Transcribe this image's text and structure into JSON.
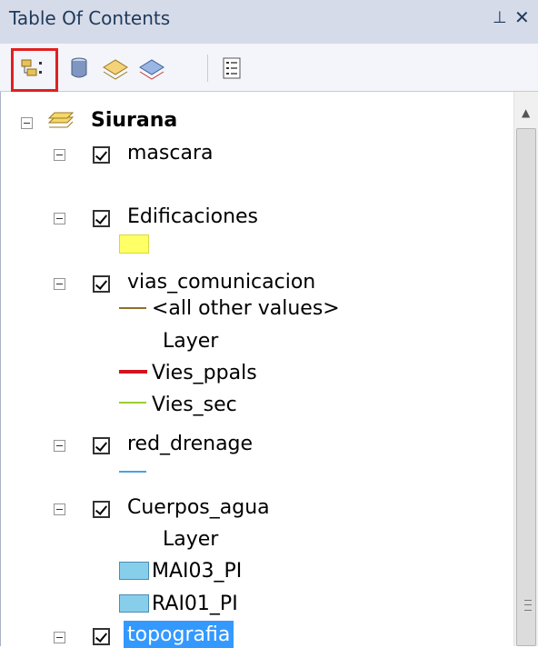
{
  "window": {
    "title": "Table Of Contents",
    "pin_glyph": "⊥",
    "close_glyph": "✕"
  },
  "toolbar": {
    "buttons": [
      {
        "name": "list-by-drawing-order-icon",
        "selected": true,
        "highlight_color": "#e02020"
      },
      {
        "name": "list-by-source-icon"
      },
      {
        "name": "list-by-visibility-icon"
      },
      {
        "name": "list-by-selection-icon"
      },
      {
        "name": "options-icon"
      }
    ]
  },
  "tree": {
    "root": {
      "label": "Siurana"
    },
    "layers": [
      {
        "label": "mascara",
        "checked": true
      },
      {
        "label": "Edificaciones",
        "checked": true,
        "swatch_color": "#ffff66"
      },
      {
        "label": "vias_comunicacion",
        "checked": true,
        "legend": [
          {
            "label": "<all other values>",
            "color": "#8b6f2a"
          },
          {
            "label": "Layer"
          },
          {
            "label": "Vies_ppals",
            "color": "#d0141c"
          },
          {
            "label": "Vies_sec",
            "color": "#9acd32"
          }
        ]
      },
      {
        "label": "red_drenage",
        "checked": true,
        "line_color": "#4aa3df"
      },
      {
        "label": "Cuerpos_agua",
        "checked": true,
        "legend": [
          {
            "label": "Layer"
          },
          {
            "label": "MAI03_PI",
            "color": "#87ceeb"
          },
          {
            "label": "RAI01_PI",
            "color": "#87ceeb"
          }
        ]
      },
      {
        "label": "topografia",
        "checked": true,
        "selected": true,
        "selection_color": "#3399ff"
      }
    ]
  }
}
